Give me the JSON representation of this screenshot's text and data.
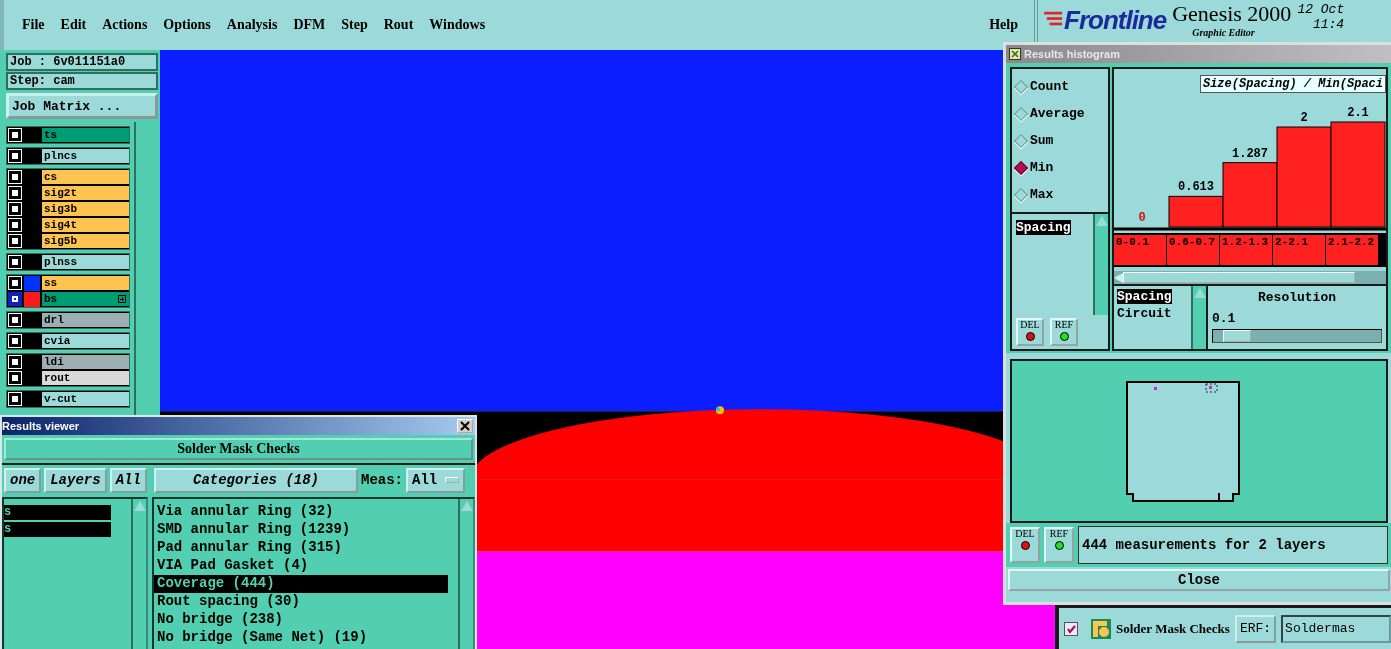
{
  "menu_bar": {
    "items": [
      "File",
      "Edit",
      "Actions",
      "Options",
      "Analysis",
      "DFM",
      "Step",
      "Rout",
      "Windows"
    ],
    "help": "Help"
  },
  "brand": {
    "logo": "Frontline",
    "product": "Genesis 2000",
    "subtitle": "Graphic Editor",
    "date": "12 Oct",
    "time": "11:4"
  },
  "job_panel": {
    "job": "Job : 6v011151a0",
    "step": "Step: cam",
    "matrix_button": "Job Matrix ...",
    "layer_groups": [
      {
        "layers": [
          {
            "name": "ts",
            "color": "#009c73",
            "selected": false
          }
        ]
      },
      {
        "layers": [
          {
            "name": "plncs",
            "color": "#9cd9d9",
            "selected": false
          }
        ]
      },
      {
        "layers": [
          {
            "name": "cs",
            "color": "#ffc34f",
            "selected": false
          },
          {
            "name": "sig2t",
            "color": "#ffc34f",
            "selected": false
          },
          {
            "name": "sig3b",
            "color": "#ffc34f",
            "selected": false
          },
          {
            "name": "sig4t",
            "color": "#ffc34f",
            "selected": false
          },
          {
            "name": "sig5b",
            "color": "#ffc34f",
            "selected": false
          }
        ]
      },
      {
        "layers": [
          {
            "name": "plnss",
            "color": "#9cd9d9",
            "selected": false
          }
        ]
      },
      {
        "layers": [
          {
            "name": "ss",
            "color": "#ffc34f",
            "swatch": {
              "color": "#0033ff"
            },
            "selected": false
          },
          {
            "name": "bs",
            "color": "#009c73",
            "swatch": {
              "color": "#ff1a1a"
            },
            "selected": true
          }
        ]
      },
      {
        "layers": [
          {
            "name": "drl",
            "color": "#9cb0b4",
            "selected": false
          }
        ]
      },
      {
        "layers": [
          {
            "name": "cvia",
            "color": "#9cd9d9",
            "selected": false
          }
        ]
      },
      {
        "layers": [
          {
            "name": "ldi",
            "color": "#9cb0b4",
            "selected": false
          },
          {
            "name": "rout",
            "color": "#d9d9d9",
            "selected": false
          }
        ]
      },
      {
        "layers": [
          {
            "name": "v-cut",
            "color": "#9cd9d9",
            "selected": false
          }
        ]
      }
    ]
  },
  "results_viewer": {
    "title": "Results viewer",
    "header": "Solder Mask Checks",
    "none_button": "one",
    "layers_button": "Layers",
    "all_button": "All",
    "categories_button": "Categories (18)",
    "meas_label": "Meas:",
    "meas_value": "All",
    "layers": [
      {
        "name": "s",
        "selected": true
      },
      {
        "name": "s",
        "selected": true
      }
    ],
    "categories": [
      {
        "label": "Via annular Ring (32)",
        "selected": false
      },
      {
        "label": "SMD annular Ring (1239)",
        "selected": false
      },
      {
        "label": "Pad annular Ring (315)",
        "selected": false
      },
      {
        "label": "VIA Pad Gasket (4)",
        "selected": false
      },
      {
        "label": "Coverage (444)",
        "selected": true
      },
      {
        "label": "Rout spacing (30)",
        "selected": false
      },
      {
        "label": "No bridge (238)",
        "selected": false
      },
      {
        "label": "No bridge (Same Net) (19)",
        "selected": false
      }
    ]
  },
  "results_histogram": {
    "title": "Results histogram",
    "modes": [
      {
        "label": "Count",
        "selected": false
      },
      {
        "label": "Average",
        "selected": false
      },
      {
        "label": "Sum",
        "selected": false
      },
      {
        "label": "Min",
        "selected": true
      },
      {
        "label": "Max",
        "selected": false
      }
    ],
    "measures": [
      {
        "label": "Spacing",
        "selected": true
      }
    ],
    "del_button": "DEL",
    "ref_button": "REF",
    "chart_data": {
      "type": "bar",
      "title": "Size(Spacing) / Min(Spaci",
      "categories": [
        "0-0.1",
        "0.6-0.7",
        "1.2-1.3",
        "2-2.1",
        "2.1-2.2"
      ],
      "values": [
        0,
        0.613,
        1.287,
        2,
        2.1
      ],
      "data_labels": true
    },
    "value_labels": [
      "0",
      "0.613",
      "1.287",
      "2",
      "2.1"
    ],
    "sizes": [
      {
        "label": "Spacing",
        "selected": true
      },
      {
        "label": "Circuit",
        "selected": false
      }
    ],
    "resolution_label": "Resolution",
    "resolution_value": "0.1",
    "resolution": {
      "level": 0.06
    },
    "preview_del_button": "DEL",
    "preview_ref_button": "REF",
    "message": "444 measurements for 2 layers",
    "close_button": "Close"
  },
  "erf_bar": {
    "checked": true,
    "label": "Solder Mask Checks",
    "erf_label": "ERF:",
    "erf_value": "Soldermas"
  }
}
